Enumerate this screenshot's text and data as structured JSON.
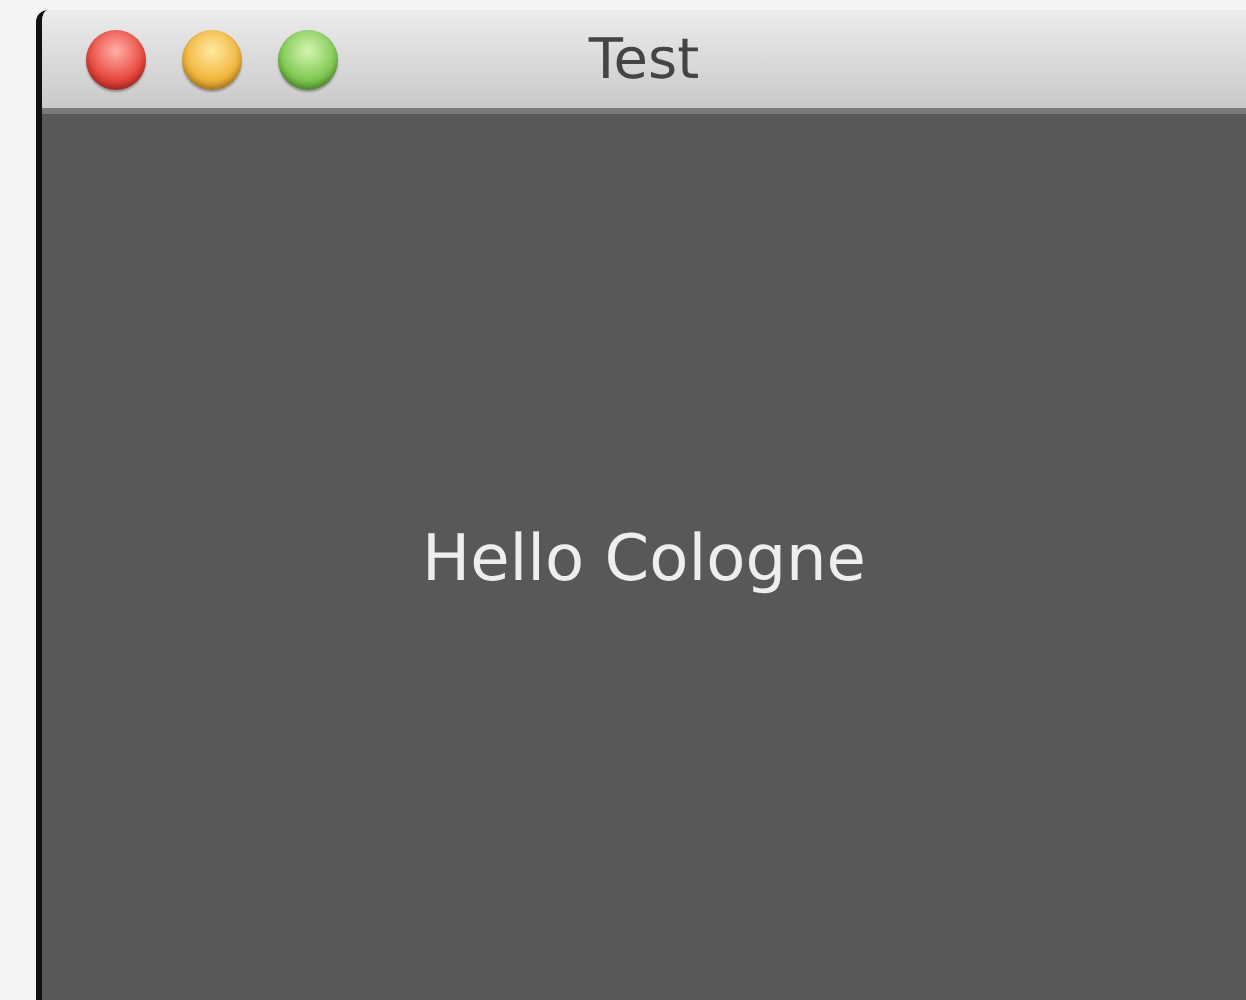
{
  "window": {
    "title": "Test"
  },
  "content": {
    "label": "Hello Cologne"
  }
}
